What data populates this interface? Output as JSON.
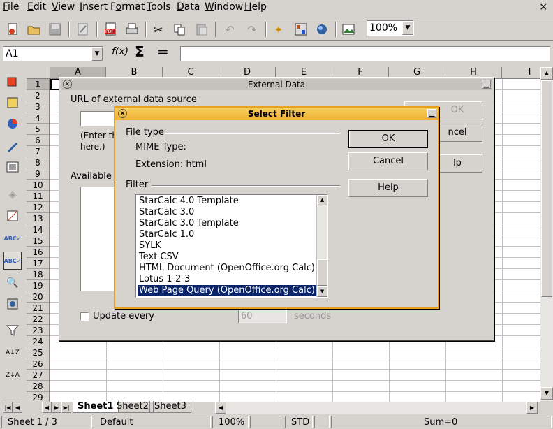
{
  "menubar": {
    "items": [
      {
        "label": "File",
        "u": "F",
        "rest": "ile"
      },
      {
        "label": "Edit",
        "u": "E",
        "rest": "dit"
      },
      {
        "label": "View",
        "u": "V",
        "rest": "iew"
      },
      {
        "label": "Insert",
        "u": "I",
        "rest": "nsert"
      },
      {
        "label": "Format",
        "pre": "F",
        "u": "o",
        "rest": "rmat"
      },
      {
        "label": "Tools",
        "u": "T",
        "rest": "ools"
      },
      {
        "label": "Data",
        "u": "D",
        "rest": "ata"
      },
      {
        "label": "Window",
        "u": "W",
        "rest": "indow"
      },
      {
        "label": "Help",
        "u": "H",
        "rest": "elp"
      }
    ],
    "close_glyph": "×"
  },
  "toolbar": {
    "zoom": "100%"
  },
  "formula_bar": {
    "name_box": "A1",
    "fx_label": "f(x)",
    "sum_label": "Σ",
    "equals_label": "=",
    "formula": ""
  },
  "grid": {
    "columns": [
      "A",
      "B",
      "C",
      "D",
      "E",
      "F",
      "G",
      "H",
      "I"
    ],
    "rows": [
      "1",
      "2",
      "3",
      "4",
      "5",
      "6",
      "7",
      "8",
      "9",
      "10",
      "11",
      "12",
      "13",
      "14",
      "15",
      "16",
      "17",
      "18",
      "19",
      "20",
      "21",
      "22",
      "23",
      "24",
      "25",
      "26",
      "27",
      "28",
      "29"
    ]
  },
  "sheet_tabs": [
    "Sheet1",
    "Sheet2",
    "Sheet3"
  ],
  "status_bar": {
    "sheet": "Sheet 1 / 3",
    "style": "Default",
    "zoom": "100%",
    "mode": "STD",
    "sum": "Sum=0"
  },
  "external_data": {
    "title": "External Data",
    "url_label_pre": "URL of ",
    "url_label_u": "e",
    "url_label_post": "xternal data source",
    "hint_line1": "(Enter th",
    "hint_line2": "here.)",
    "available_label": "Available t",
    "ok_label": "OK",
    "cancel_label": "ncel",
    "help_label": "lp",
    "update_label": "Update every",
    "update_value": "60",
    "seconds_label": "seconds"
  },
  "select_filter": {
    "title": "Select Filter",
    "file_type_label": "File type",
    "mime_label": "MIME Type:",
    "extension_label": "Extension: html",
    "filter_label": "Filter",
    "ok_label": "OK",
    "cancel_label": "Cancel",
    "help_label": "Help",
    "filters": [
      "StarCalc 4.0 Template",
      "StarCalc 3.0",
      "StarCalc 3.0 Template",
      "StarCalc 1.0",
      "SYLK",
      "Text CSV",
      "HTML Document (OpenOffice.org Calc)",
      "Lotus 1-2-3",
      "Web Page Query (OpenOffice.org Calc)"
    ],
    "selected_index": 8
  }
}
